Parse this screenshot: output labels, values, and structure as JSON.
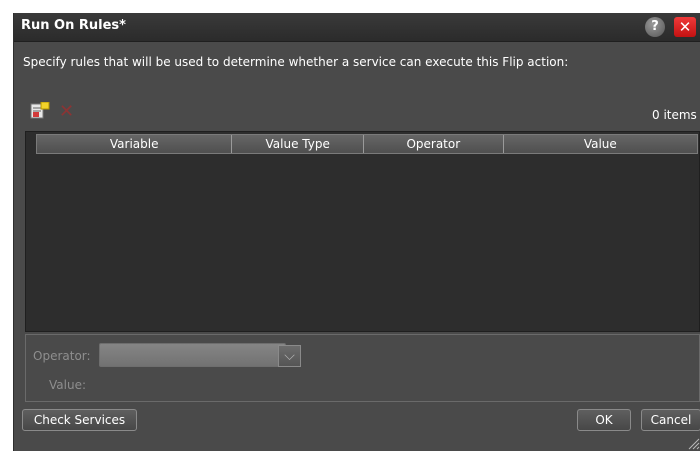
{
  "dialog": {
    "title": "Run On Rules*",
    "help_label": "?",
    "close_label": "✕"
  },
  "instruction": "Specify rules that will be used to determine whether a service can execute this Flip action:",
  "toolbar": {
    "items_count": "0 items",
    "add_icon": "add-rule-icon",
    "delete_icon": "delete-rule-icon"
  },
  "table": {
    "columns": [
      "Variable",
      "Value Type",
      "Operator",
      "Value"
    ],
    "rows": []
  },
  "editor": {
    "operator_label": "Operator:",
    "operator_value": "",
    "value_label": "Value:"
  },
  "buttons": {
    "check_services": "Check Services",
    "ok": "OK",
    "cancel": "Cancel"
  },
  "colors": {
    "background": "#4a4a4a",
    "titlebar": "#2b2b2b",
    "table_background": "#2d2d2d",
    "close_red": "#d62020"
  }
}
